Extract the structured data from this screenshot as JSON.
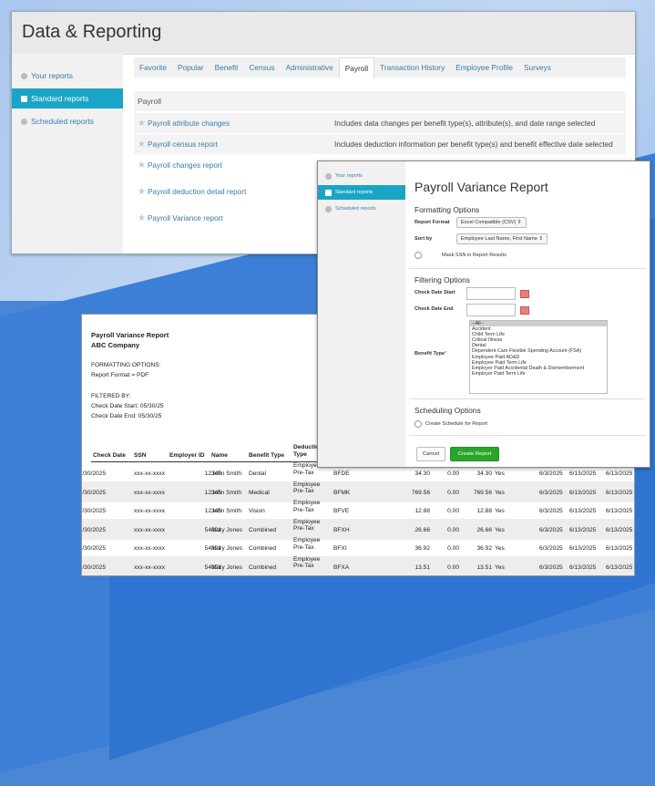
{
  "main_window": {
    "title": "Data & Reporting",
    "sidebar": [
      {
        "label": "Your reports",
        "active": false
      },
      {
        "label": "Standard reports",
        "active": true
      },
      {
        "label": "Scheduled reports",
        "active": false
      }
    ],
    "tabs": [
      "Favorite",
      "Popular",
      "Benefit",
      "Census",
      "Administrative",
      "Payroll",
      "Transaction History",
      "Employee Profile",
      "Surveys"
    ],
    "active_tab": "Payroll",
    "section_label": "Payroll",
    "reports": [
      {
        "name": "Payroll attribute changes",
        "description": "Includes data changes per benefit type(s), attribute(s), and date range selected"
      },
      {
        "name": "Payroll census report",
        "description": "Includes deduction information per benefit type(s) and benefit effective date selected"
      },
      {
        "name": "Payroll changes report",
        "description": ""
      },
      {
        "name": "Payroll deduction detail report",
        "description": ""
      },
      {
        "name": "Payroll Variance report",
        "description": ""
      }
    ]
  },
  "modal": {
    "sidebar": [
      {
        "label": "Your reports"
      },
      {
        "label": "Standard reports"
      },
      {
        "label": "Scheduled reports"
      }
    ],
    "title": "Payroll Variance Report",
    "formatting_heading": "Formatting Options",
    "report_format_label": "Report Format",
    "report_format_value": "Excel Compatible (CSV)",
    "sort_by_label": "Sort by",
    "sort_by_value": "Employee Last Name, First Name",
    "mask_ssn_label": "Mask SSN in Report Results",
    "filtering_heading": "Filtering Options",
    "check_date_start_label": "Check Date Start",
    "check_date_end_label": "Check Date End",
    "benefit_type_label": "Benefit Type",
    "benefit_types": [
      "--All--",
      "Accident",
      "Child Term Life",
      "Critical Illness",
      "Dental",
      "Dependent Care Flexible Spending Account (FSA)",
      "Employee Paid AD&D",
      "Employee Paid Term Life",
      "Employer Paid Accidental Death & Dismemberment",
      "Employer Paid Term Life"
    ],
    "scheduling_heading": "Scheduling Options",
    "create_schedule_label": "Create Schedule for Report",
    "cancel_label": "Cancel",
    "create_label": "Create Report",
    "accent_color": "#2aa52a"
  },
  "spreadsheet": {
    "title": "Payroll Variance Report",
    "company": "ABC Company",
    "formatting_options": "FORMATTING OPTIONS:",
    "report_format": "Report Format = PDF",
    "filtered_by": "FILTERED BY:",
    "check_date_start": "Check Date Start: 05/30/25",
    "check_date_end": "Check Date End: 05/30/25",
    "headers": [
      "Check Date",
      "SSN",
      "Employer ID",
      "Name",
      "Benefit Type",
      "Deduction Type"
    ],
    "rows": [
      {
        "date": "5/30/2025",
        "ssn": "xxx-xx-xxxx",
        "emp": "12345",
        "name": "John Smith",
        "benefit": "Dental",
        "type": "Employee Pre-Tax",
        "code": "BFDE",
        "a": "34.30",
        "b": "0.00",
        "c": "34.30",
        "yn": "Yes",
        "d1": "6/3/2025",
        "d2": "6/13/2025",
        "d3": "6/13/2025"
      },
      {
        "date": "5/30/2025",
        "ssn": "xxx-xx-xxxx",
        "emp": "12345",
        "name": "John Smith",
        "benefit": "Medical",
        "type": "Employee Pre-Tax",
        "code": "BFMK",
        "a": "769.56",
        "b": "0.00",
        "c": "769.56",
        "yn": "Yes",
        "d1": "6/3/2025",
        "d2": "6/13/2025",
        "d3": "6/13/2025"
      },
      {
        "date": "5/30/2025",
        "ssn": "xxx-xx-xxxx",
        "emp": "12345",
        "name": "John Smith",
        "benefit": "Vision",
        "type": "Employee Pre-Tax",
        "code": "BFVE",
        "a": "12.88",
        "b": "0.00",
        "c": "12.88",
        "yn": "Yes",
        "d1": "6/3/2025",
        "d2": "6/13/2025",
        "d3": "6/13/2025"
      },
      {
        "date": "5/30/2025",
        "ssn": "xxx-xx-xxxx",
        "emp": "54321",
        "name": "Mary Jones",
        "benefit": "Combined",
        "type": "Employee Pre-Tax",
        "code": "BFXH",
        "a": "26.66",
        "b": "0.00",
        "c": "26.66",
        "yn": "Yes",
        "d1": "6/3/2025",
        "d2": "6/13/2025",
        "d3": "6/13/2025"
      },
      {
        "date": "5/30/2025",
        "ssn": "xxx-xx-xxxx",
        "emp": "54321",
        "name": "Mary Jones",
        "benefit": "Combined",
        "type": "Employee Pre-Tax",
        "code": "BFXI",
        "a": "36.92",
        "b": "0.00",
        "c": "36.92",
        "yn": "Yes",
        "d1": "6/3/2025",
        "d2": "6/13/2025",
        "d3": "6/13/2025"
      },
      {
        "date": "5/30/2025",
        "ssn": "xxx-xx-xxxx",
        "emp": "54321",
        "name": "Mary Jones",
        "benefit": "Combined",
        "type": "Employee Pre-Tax",
        "code": "BFXA",
        "a": "13.51",
        "b": "0.00",
        "c": "13.51",
        "yn": "Yes",
        "d1": "6/3/2025",
        "d2": "6/13/2025",
        "d3": "6/13/2025"
      }
    ]
  }
}
